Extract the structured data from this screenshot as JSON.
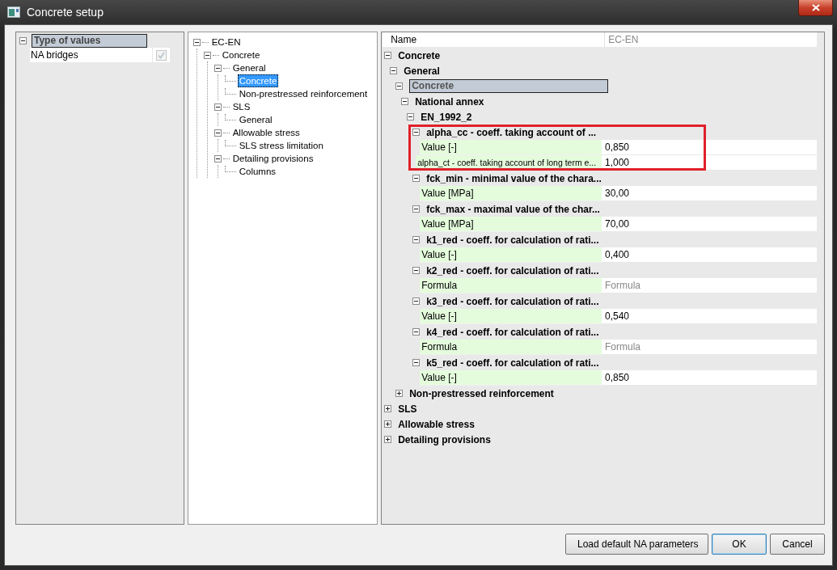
{
  "window": {
    "title": "Concrete setup"
  },
  "categories": {
    "label": "Type of values",
    "expanded": true,
    "selected": true,
    "items": [
      {
        "label": "NA bridges",
        "checked": true,
        "disabled": true
      }
    ]
  },
  "tree": [
    {
      "label": "EC-EN",
      "expanded": true,
      "selected": false,
      "children": [
        {
          "label": "Concrete",
          "expanded": true,
          "selected": false,
          "children": [
            {
              "label": "General",
              "expanded": true,
              "selected": false,
              "children": [
                {
                  "label": "Concrete",
                  "selected": true
                },
                {
                  "label": "Non-prestressed reinforcement",
                  "selected": false
                }
              ]
            },
            {
              "label": "SLS",
              "expanded": true,
              "selected": false,
              "children": [
                {
                  "label": "General",
                  "selected": false
                }
              ]
            },
            {
              "label": "Allowable stress",
              "expanded": true,
              "selected": false,
              "children": [
                {
                  "label": "SLS stress limitation",
                  "selected": false
                }
              ]
            },
            {
              "label": "Detailing provisions",
              "expanded": true,
              "selected": false,
              "children": [
                {
                  "label": "Columns",
                  "selected": false
                }
              ]
            }
          ]
        }
      ]
    }
  ],
  "grid": {
    "header": {
      "name": "Name",
      "value": "EC-EN"
    },
    "rows": [
      {
        "kind": "group",
        "label": "Concrete",
        "expanded": true,
        "selected": false,
        "highlighted": false,
        "children": [
          {
            "kind": "group",
            "label": "General",
            "expanded": true,
            "selected": false,
            "highlighted": false,
            "children": [
              {
                "kind": "group",
                "label": "Concrete",
                "expanded": true,
                "selected": true,
                "highlighted": false,
                "children": [
                  {
                    "kind": "group",
                    "label": "National annex",
                    "expanded": true,
                    "selected": false,
                    "highlighted": false,
                    "children": [
                      {
                        "kind": "group",
                        "label": "EN_1992_2",
                        "expanded": true,
                        "selected": false,
                        "highlighted": false,
                        "children": [
                          {
                            "kind": "group",
                            "label": "alpha_cc -  coeff. taking account of ...",
                            "expanded": true,
                            "selected": false,
                            "highlighted": true,
                            "children": [
                              {
                                "kind": "property",
                                "label": "Value [-]",
                                "value": "0,850",
                                "disabled": false
                              },
                              {
                                "kind": "subproperty",
                                "label": "alpha_ct - coeff. taking account of long term e...",
                                "value": "1,000",
                                "disabled": false
                              }
                            ]
                          },
                          {
                            "kind": "group",
                            "label": "fck_min - minimal value of the chara...",
                            "expanded": true,
                            "selected": false,
                            "highlighted": false,
                            "children": [
                              {
                                "kind": "property",
                                "label": "Value [MPa]",
                                "value": "30,00",
                                "disabled": false
                              }
                            ]
                          },
                          {
                            "kind": "group",
                            "label": "fck_max - maximal value of the char...",
                            "expanded": true,
                            "selected": false,
                            "highlighted": false,
                            "children": [
                              {
                                "kind": "property",
                                "label": "Value [MPa]",
                                "value": "70,00",
                                "disabled": false
                              }
                            ]
                          },
                          {
                            "kind": "group",
                            "label": "k1_red - coeff. for calculation of rati...",
                            "expanded": true,
                            "selected": false,
                            "highlighted": false,
                            "children": [
                              {
                                "kind": "property",
                                "label": "Value [-]",
                                "value": "0,400",
                                "disabled": false
                              }
                            ]
                          },
                          {
                            "kind": "group",
                            "label": "k2_red - coeff. for calculation of rati...",
                            "expanded": true,
                            "selected": false,
                            "highlighted": false,
                            "children": [
                              {
                                "kind": "property",
                                "label": "Formula",
                                "value": "Formula",
                                "disabled": true
                              }
                            ]
                          },
                          {
                            "kind": "group",
                            "label": "k3_red - coeff. for calculation of rati...",
                            "expanded": true,
                            "selected": false,
                            "highlighted": false,
                            "children": [
                              {
                                "kind": "property",
                                "label": "Value [-]",
                                "value": "0,540",
                                "disabled": false
                              }
                            ]
                          },
                          {
                            "kind": "group",
                            "label": "k4_red - coeff. for calculation of rati...",
                            "expanded": true,
                            "selected": false,
                            "highlighted": false,
                            "children": [
                              {
                                "kind": "property",
                                "label": "Formula",
                                "value": "Formula",
                                "disabled": true
                              }
                            ]
                          },
                          {
                            "kind": "group",
                            "label": "k5_red - coeff. for calculation of rati...",
                            "expanded": true,
                            "selected": false,
                            "highlighted": false,
                            "children": [
                              {
                                "kind": "property",
                                "label": "Value [-]",
                                "value": "0,850",
                                "disabled": false
                              }
                            ]
                          }
                        ]
                      }
                    ]
                  }
                ]
              },
              {
                "kind": "group",
                "label": "Non-prestressed reinforcement",
                "expanded": false,
                "selected": false,
                "highlighted": false
              }
            ]
          }
        ]
      },
      {
        "kind": "group",
        "label": "SLS",
        "expanded": false,
        "selected": false,
        "highlighted": false
      },
      {
        "kind": "group",
        "label": "Allowable stress",
        "expanded": false,
        "selected": false,
        "highlighted": false
      },
      {
        "kind": "group",
        "label": "Detailing provisions",
        "expanded": false,
        "selected": false,
        "highlighted": false
      }
    ]
  },
  "buttons": [
    {
      "label": "Load default NA parameters",
      "default": false
    },
    {
      "label": "OK",
      "default": true
    },
    {
      "label": "Cancel",
      "default": false
    }
  ]
}
